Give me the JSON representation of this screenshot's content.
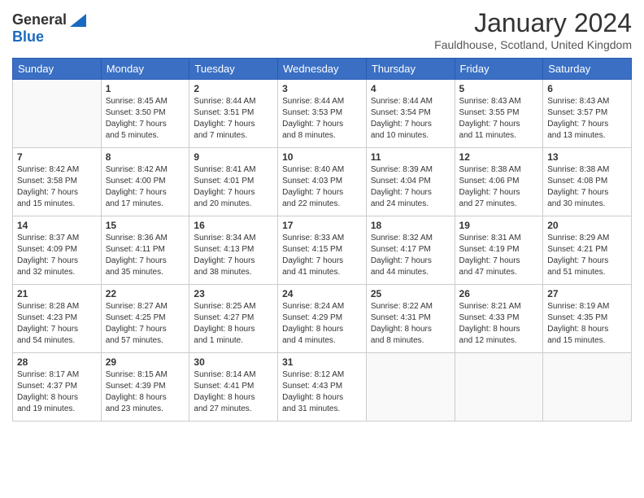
{
  "header": {
    "logo_general": "General",
    "logo_blue": "Blue",
    "title": "January 2024",
    "location": "Fauldhouse, Scotland, United Kingdom"
  },
  "days_of_week": [
    "Sunday",
    "Monday",
    "Tuesday",
    "Wednesday",
    "Thursday",
    "Friday",
    "Saturday"
  ],
  "weeks": [
    [
      {
        "day": "",
        "info": ""
      },
      {
        "day": "1",
        "info": "Sunrise: 8:45 AM\nSunset: 3:50 PM\nDaylight: 7 hours\nand 5 minutes."
      },
      {
        "day": "2",
        "info": "Sunrise: 8:44 AM\nSunset: 3:51 PM\nDaylight: 7 hours\nand 7 minutes."
      },
      {
        "day": "3",
        "info": "Sunrise: 8:44 AM\nSunset: 3:53 PM\nDaylight: 7 hours\nand 8 minutes."
      },
      {
        "day": "4",
        "info": "Sunrise: 8:44 AM\nSunset: 3:54 PM\nDaylight: 7 hours\nand 10 minutes."
      },
      {
        "day": "5",
        "info": "Sunrise: 8:43 AM\nSunset: 3:55 PM\nDaylight: 7 hours\nand 11 minutes."
      },
      {
        "day": "6",
        "info": "Sunrise: 8:43 AM\nSunset: 3:57 PM\nDaylight: 7 hours\nand 13 minutes."
      }
    ],
    [
      {
        "day": "7",
        "info": "Sunrise: 8:42 AM\nSunset: 3:58 PM\nDaylight: 7 hours\nand 15 minutes."
      },
      {
        "day": "8",
        "info": "Sunrise: 8:42 AM\nSunset: 4:00 PM\nDaylight: 7 hours\nand 17 minutes."
      },
      {
        "day": "9",
        "info": "Sunrise: 8:41 AM\nSunset: 4:01 PM\nDaylight: 7 hours\nand 20 minutes."
      },
      {
        "day": "10",
        "info": "Sunrise: 8:40 AM\nSunset: 4:03 PM\nDaylight: 7 hours\nand 22 minutes."
      },
      {
        "day": "11",
        "info": "Sunrise: 8:39 AM\nSunset: 4:04 PM\nDaylight: 7 hours\nand 24 minutes."
      },
      {
        "day": "12",
        "info": "Sunrise: 8:38 AM\nSunset: 4:06 PM\nDaylight: 7 hours\nand 27 minutes."
      },
      {
        "day": "13",
        "info": "Sunrise: 8:38 AM\nSunset: 4:08 PM\nDaylight: 7 hours\nand 30 minutes."
      }
    ],
    [
      {
        "day": "14",
        "info": "Sunrise: 8:37 AM\nSunset: 4:09 PM\nDaylight: 7 hours\nand 32 minutes."
      },
      {
        "day": "15",
        "info": "Sunrise: 8:36 AM\nSunset: 4:11 PM\nDaylight: 7 hours\nand 35 minutes."
      },
      {
        "day": "16",
        "info": "Sunrise: 8:34 AM\nSunset: 4:13 PM\nDaylight: 7 hours\nand 38 minutes."
      },
      {
        "day": "17",
        "info": "Sunrise: 8:33 AM\nSunset: 4:15 PM\nDaylight: 7 hours\nand 41 minutes."
      },
      {
        "day": "18",
        "info": "Sunrise: 8:32 AM\nSunset: 4:17 PM\nDaylight: 7 hours\nand 44 minutes."
      },
      {
        "day": "19",
        "info": "Sunrise: 8:31 AM\nSunset: 4:19 PM\nDaylight: 7 hours\nand 47 minutes."
      },
      {
        "day": "20",
        "info": "Sunrise: 8:29 AM\nSunset: 4:21 PM\nDaylight: 7 hours\nand 51 minutes."
      }
    ],
    [
      {
        "day": "21",
        "info": "Sunrise: 8:28 AM\nSunset: 4:23 PM\nDaylight: 7 hours\nand 54 minutes."
      },
      {
        "day": "22",
        "info": "Sunrise: 8:27 AM\nSunset: 4:25 PM\nDaylight: 7 hours\nand 57 minutes."
      },
      {
        "day": "23",
        "info": "Sunrise: 8:25 AM\nSunset: 4:27 PM\nDaylight: 8 hours\nand 1 minute."
      },
      {
        "day": "24",
        "info": "Sunrise: 8:24 AM\nSunset: 4:29 PM\nDaylight: 8 hours\nand 4 minutes."
      },
      {
        "day": "25",
        "info": "Sunrise: 8:22 AM\nSunset: 4:31 PM\nDaylight: 8 hours\nand 8 minutes."
      },
      {
        "day": "26",
        "info": "Sunrise: 8:21 AM\nSunset: 4:33 PM\nDaylight: 8 hours\nand 12 minutes."
      },
      {
        "day": "27",
        "info": "Sunrise: 8:19 AM\nSunset: 4:35 PM\nDaylight: 8 hours\nand 15 minutes."
      }
    ],
    [
      {
        "day": "28",
        "info": "Sunrise: 8:17 AM\nSunset: 4:37 PM\nDaylight: 8 hours\nand 19 minutes."
      },
      {
        "day": "29",
        "info": "Sunrise: 8:15 AM\nSunset: 4:39 PM\nDaylight: 8 hours\nand 23 minutes."
      },
      {
        "day": "30",
        "info": "Sunrise: 8:14 AM\nSunset: 4:41 PM\nDaylight: 8 hours\nand 27 minutes."
      },
      {
        "day": "31",
        "info": "Sunrise: 8:12 AM\nSunset: 4:43 PM\nDaylight: 8 hours\nand 31 minutes."
      },
      {
        "day": "",
        "info": ""
      },
      {
        "day": "",
        "info": ""
      },
      {
        "day": "",
        "info": ""
      }
    ]
  ]
}
